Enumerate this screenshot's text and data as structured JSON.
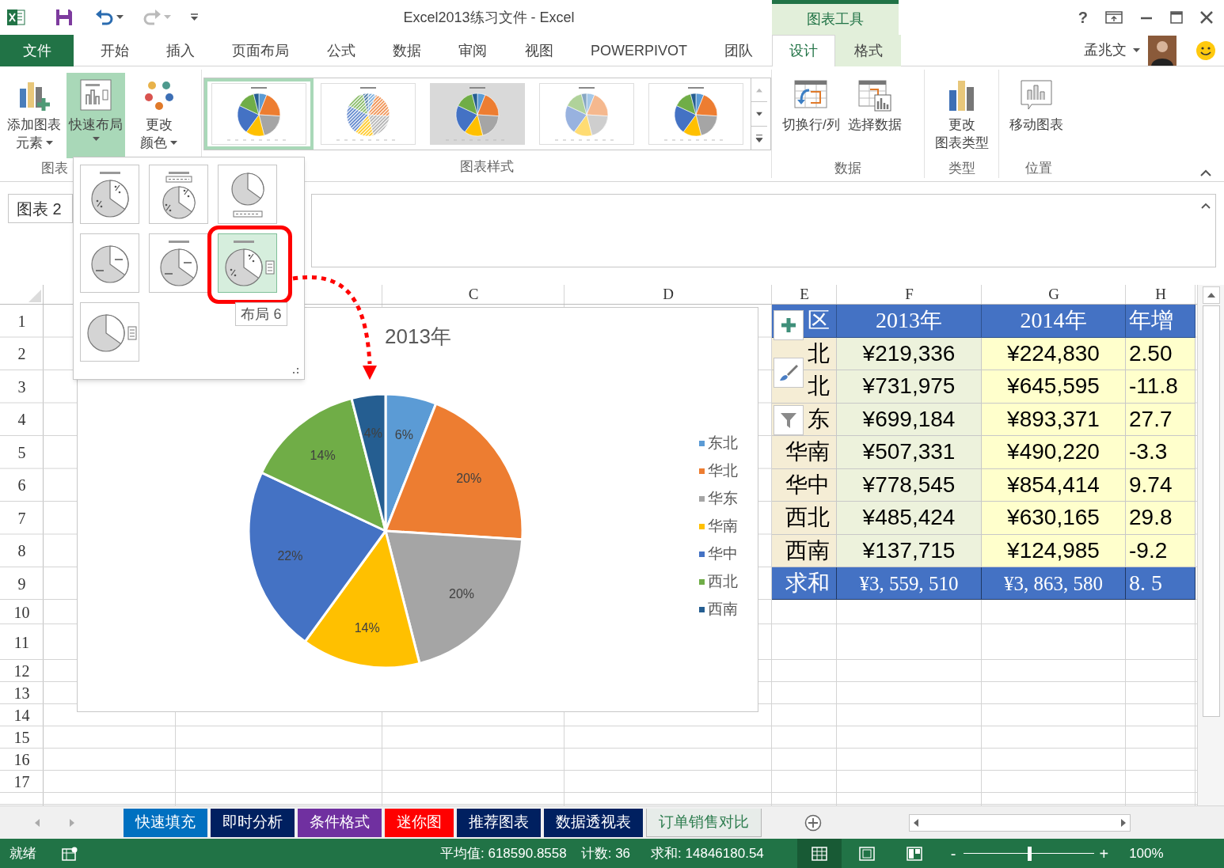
{
  "title_bar": {
    "title": "Excel2013练习文件 - Excel",
    "context_label": "图表工具",
    "help": "?"
  },
  "menu_tabs": [
    {
      "label": "文件",
      "kind": "file",
      "selected": false
    },
    {
      "label": "开始",
      "kind": "main",
      "selected": false
    },
    {
      "label": "插入",
      "kind": "main",
      "selected": false
    },
    {
      "label": "页面布局",
      "kind": "main",
      "selected": false
    },
    {
      "label": "公式",
      "kind": "main",
      "selected": false
    },
    {
      "label": "数据",
      "kind": "main",
      "selected": false
    },
    {
      "label": "审阅",
      "kind": "main",
      "selected": false
    },
    {
      "label": "视图",
      "kind": "main",
      "selected": false
    },
    {
      "label": "POWERPIVOT",
      "kind": "main",
      "selected": false
    },
    {
      "label": "团队",
      "kind": "main",
      "selected": false
    },
    {
      "label": "设计",
      "kind": "context",
      "selected": true
    },
    {
      "label": "格式",
      "kind": "context",
      "selected": false
    }
  ],
  "user": {
    "name": "孟兆文"
  },
  "ribbon": {
    "groups": [
      {
        "label": "图表",
        "kind": "buttons",
        "buttons": [
          {
            "lines": [
              "添加图表",
              "元素"
            ],
            "dropdown": true,
            "selected": false
          },
          {
            "lines": [
              "快速布局"
            ],
            "dropdown": true,
            "selected": true
          },
          {
            "lines": [
              "更改",
              "颜色"
            ],
            "dropdown": true,
            "selected": false
          }
        ]
      },
      {
        "label": "图表样式",
        "kind": "gallery",
        "styles": [
          {
            "kind": "plain",
            "selected": true
          },
          {
            "kind": "hatched",
            "selected": false
          },
          {
            "kind": "shaded",
            "selected": false
          },
          {
            "kind": "pastel",
            "selected": false
          },
          {
            "kind": "plain",
            "selected": false
          }
        ]
      },
      {
        "label": "数据",
        "kind": "buttons",
        "buttons": [
          {
            "lines": [
              "切换行/列"
            ],
            "dropdown": false,
            "selected": false
          },
          {
            "lines": [
              "选择数据"
            ],
            "dropdown": false,
            "selected": false
          }
        ]
      },
      {
        "label": "类型",
        "kind": "buttons",
        "buttons": [
          {
            "lines": [
              "更改",
              "图表类型"
            ],
            "dropdown": false,
            "selected": false
          }
        ]
      },
      {
        "label": "位置",
        "kind": "buttons",
        "buttons": [
          {
            "lines": [
              "移动图表"
            ],
            "dropdown": false,
            "selected": false
          }
        ]
      }
    ]
  },
  "formula_bar": {
    "name_box": "图表 2"
  },
  "layout_menu": {
    "tooltip": "布局 6",
    "items": [
      {
        "selected": false
      },
      {
        "selected": false
      },
      {
        "selected": false
      },
      {
        "selected": false
      },
      {
        "selected": false
      },
      {
        "selected": true
      },
      {
        "selected": false
      }
    ]
  },
  "sheet": {
    "column_headers": [
      "C",
      "D",
      "E",
      "F",
      "G",
      "H"
    ],
    "row_numbers": [
      "1",
      "2",
      "3",
      "4",
      "5",
      "6",
      "7",
      "8",
      "9",
      "10",
      "11",
      "12",
      "13",
      "14",
      "15",
      "16",
      "17"
    ],
    "table": {
      "header": [
        "区",
        "2013年",
        "2014年",
        "年增"
      ],
      "rows": [
        [
          "北",
          "¥219,336",
          "¥224,830",
          "2.50"
        ],
        [
          "北",
          "¥731,975",
          "¥645,595",
          "-11.8"
        ],
        [
          "东",
          "¥699,184",
          "¥893,371",
          "27.7"
        ],
        [
          "华南",
          "¥507,331",
          "¥490,220",
          "-3.3"
        ],
        [
          "华中",
          "¥778,545",
          "¥854,414",
          "9.74"
        ],
        [
          "西北",
          "¥485,424",
          "¥630,165",
          "29.8"
        ],
        [
          "西南",
          "¥137,715",
          "¥124,985",
          "-9.2"
        ]
      ],
      "total": [
        "求和",
        "¥3, 559, 510",
        "¥3, 863, 580",
        "8. 5"
      ]
    }
  },
  "chart": {
    "chart_data": {
      "type": "pie",
      "title": "2013年",
      "categories": [
        "东北",
        "华北",
        "华东",
        "华南",
        "华中",
        "西北",
        "西南"
      ],
      "series": [
        {
          "values": [
            6,
            20,
            20,
            14,
            22,
            14,
            4
          ]
        }
      ],
      "value_labels": [
        "6%",
        "20%",
        "20%",
        "14%",
        "22%",
        "14%",
        "4%"
      ],
      "colors": [
        "#5b9bd5",
        "#ed7d31",
        "#a5a5a5",
        "#ffc000",
        "#4472c4",
        "#70ad47",
        "#255e91"
      ]
    }
  },
  "sheet_tabs": [
    {
      "label": "快速填充",
      "color": "#0070c0",
      "selected": false
    },
    {
      "label": "即时分析",
      "color": "#002060",
      "selected": false
    },
    {
      "label": "条件格式",
      "color": "#7030a0",
      "selected": false
    },
    {
      "label": "迷你图",
      "color": "#ff0000",
      "selected": false
    },
    {
      "label": "推荐图表",
      "color": "#002060",
      "selected": false
    },
    {
      "label": "数据透视表",
      "color": "#002060",
      "selected": false
    },
    {
      "label": "订单销售对比",
      "color": "#e7ece9",
      "selected": true
    }
  ],
  "status_bar": {
    "status": "就绪",
    "average": "平均值: 618590.8558",
    "count": "计数: 36",
    "sum": "求和: 14846180.54",
    "views": [
      {
        "kind": "normal",
        "selected": true
      },
      {
        "kind": "page-layout",
        "selected": false
      },
      {
        "kind": "page-break",
        "selected": false
      }
    ],
    "zoom_out": "-",
    "zoom_in": "+",
    "zoom": {
      "level": 0.5,
      "reading": "100%"
    }
  }
}
